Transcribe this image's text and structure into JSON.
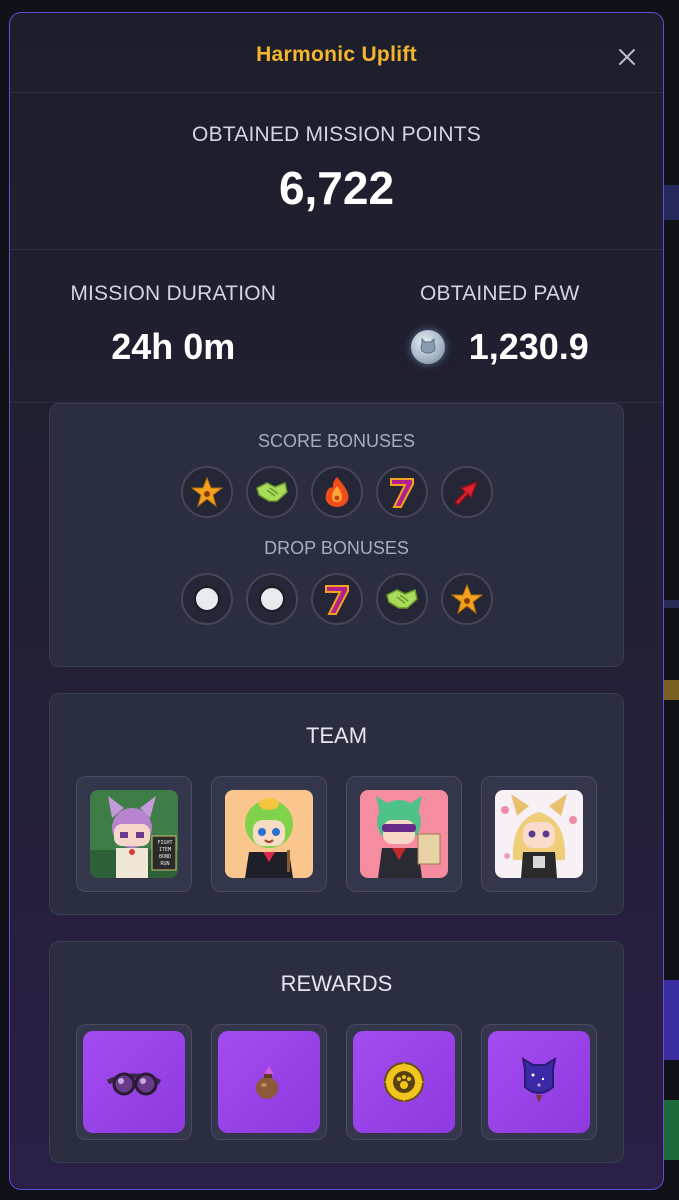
{
  "modal": {
    "title": "Harmonic Uplift",
    "close_icon": "close-icon"
  },
  "points": {
    "label": "OBTAINED MISSION POINTS",
    "value": "6,722"
  },
  "duration": {
    "label": "MISSION DURATION",
    "value": "24h 0m"
  },
  "paw": {
    "label": "OBTAINED PAW",
    "value": "1,230.9",
    "icon": "paw-coin-icon"
  },
  "score_bonuses": {
    "label": "SCORE BONUSES",
    "icons": [
      "star-paw-icon",
      "handshake-icon",
      "fire-paw-icon",
      "lucky-seven-icon",
      "rising-arrow-icon"
    ]
  },
  "drop_bonuses": {
    "label": "DROP BONUSES",
    "icons": [
      "empty-slot-icon",
      "empty-slot-icon",
      "lucky-seven-icon",
      "handshake-icon",
      "star-paw-icon"
    ]
  },
  "team": {
    "label": "TEAM",
    "members": [
      {
        "icon": "cat-girl-pink-avatar",
        "menu_text": [
          "FIGHT",
          "ITEM",
          "BOND",
          "RUN"
        ]
      },
      {
        "icon": "green-hair-boy-avatar"
      },
      {
        "icon": "green-hair-sunglasses-avatar"
      },
      {
        "icon": "blonde-fox-girl-avatar"
      }
    ]
  },
  "rewards": {
    "label": "REWARDS",
    "items": [
      "goggles-icon",
      "seed-pouch-icon",
      "sunflower-paw-icon",
      "cosmic-cat-badge-icon"
    ]
  },
  "colors": {
    "title": "#f5b62e",
    "border": "#5b4fd6",
    "reward_bg": "#a24bf0"
  }
}
